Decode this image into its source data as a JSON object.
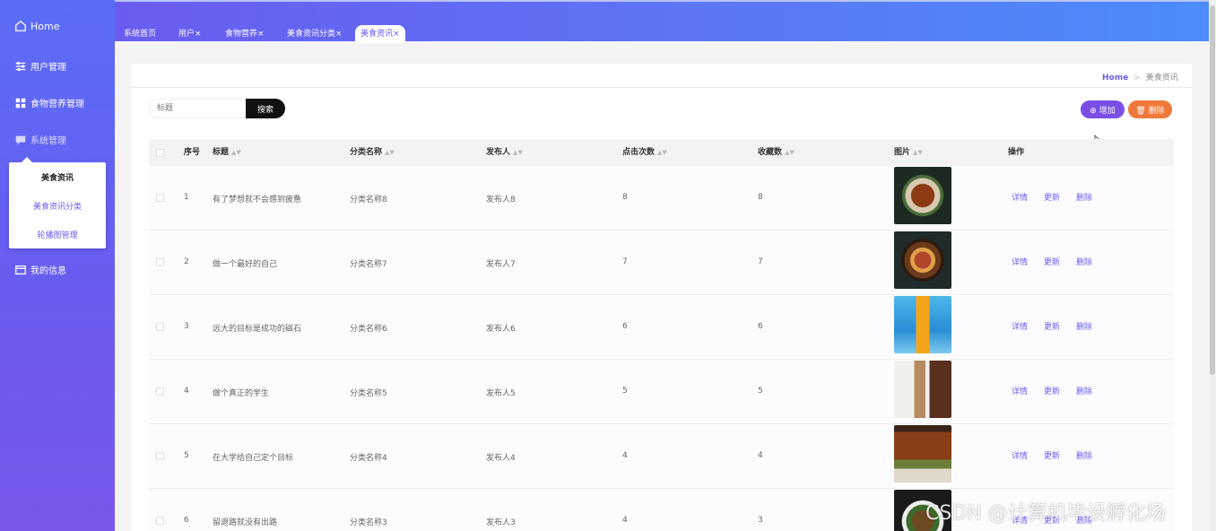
{
  "sidebar": {
    "home": "Home",
    "user_mgmt": "用户管理",
    "food_mgmt": "食物营养管理",
    "sys_mgmt": "系统管理",
    "sub_items": [
      "美食资讯",
      "美食资讯分类",
      "轮播图管理"
    ],
    "my_info": "我的信息"
  },
  "tabs": [
    "系统首页",
    "用户×",
    "食物营养×",
    "美食资讯分类×",
    "美食资讯×"
  ],
  "breadcrumb": {
    "home": "Home",
    "sep": ">",
    "current": "美食资讯"
  },
  "search": {
    "placeholder": "标题",
    "button": "搜索"
  },
  "actions": {
    "add": "增加",
    "delete": "删除"
  },
  "table": {
    "headers": [
      "序号",
      "标题",
      "分类名称",
      "发布人",
      "点击次数",
      "收藏数",
      "图片",
      "操作"
    ],
    "row_ops": [
      "详情",
      "更新",
      "删除"
    ],
    "rows": [
      {
        "no": "1",
        "title": "有了梦想就不会感到疲惫",
        "category": "分类名称8",
        "author": "发布人8",
        "clicks": "8",
        "favs": "8",
        "image": "braised-duck"
      },
      {
        "no": "2",
        "title": "做一个最好的自己",
        "category": "分类名称7",
        "author": "发布人7",
        "clicks": "7",
        "favs": "7",
        "image": "clay-pot-stew"
      },
      {
        "no": "3",
        "title": "远大的目标是成功的磁石",
        "category": "分类名称6",
        "author": "发布人6",
        "clicks": "6",
        "favs": "6",
        "image": "juice-bottle"
      },
      {
        "no": "4",
        "title": "做个真正的学生",
        "category": "分类名称5",
        "author": "发布人5",
        "clicks": "5",
        "favs": "5",
        "image": "milk-tea-cake"
      },
      {
        "no": "5",
        "title": "在大学给自己定个目标",
        "category": "分类名称4",
        "author": "发布人4",
        "clicks": "4",
        "favs": "4",
        "image": "grilled-fish"
      },
      {
        "no": "6",
        "title": "留退路就没有出路",
        "category": "分类名称3",
        "author": "发布人3",
        "clicks": "4",
        "favs": "3",
        "image": "stir-fry-dish"
      }
    ]
  },
  "watermark": "CSDN @计算机毕设孵化场",
  "colors": {
    "accent": "#6a5cf0",
    "add": "#7b4fe6",
    "delete": "#f0783a"
  }
}
